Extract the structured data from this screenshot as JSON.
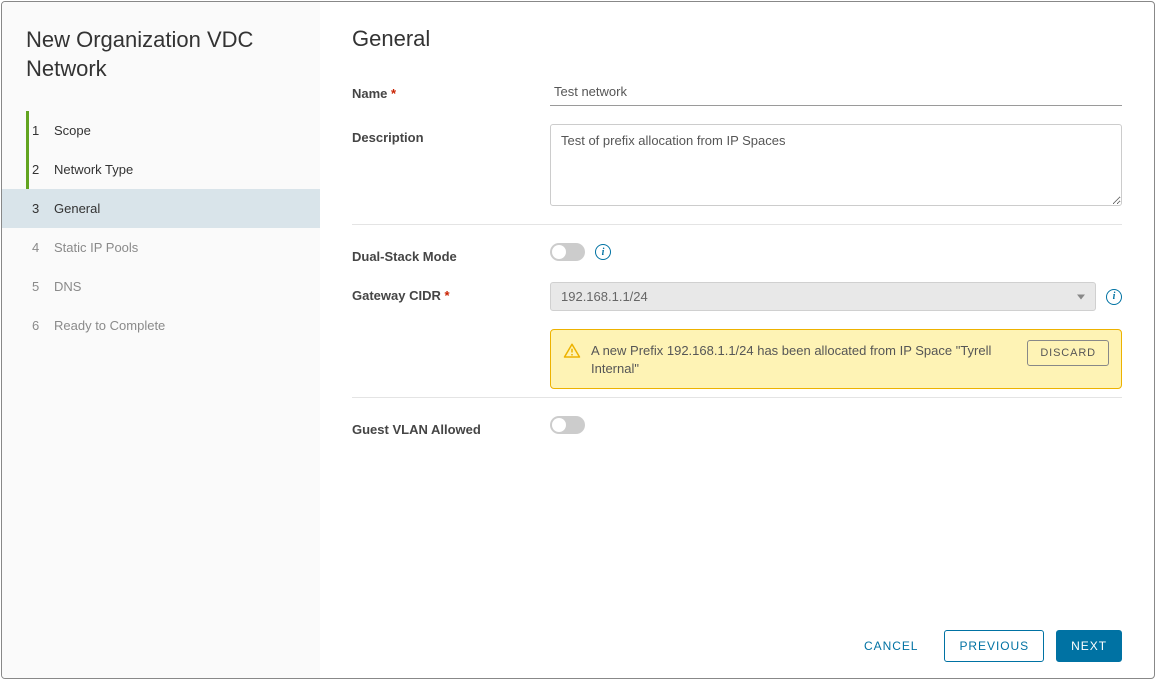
{
  "sidebar": {
    "title": "New Organization VDC Network",
    "steps": [
      {
        "num": "1",
        "label": "Scope",
        "state": "completed"
      },
      {
        "num": "2",
        "label": "Network Type",
        "state": "completed"
      },
      {
        "num": "3",
        "label": "General",
        "state": "active"
      },
      {
        "num": "4",
        "label": "Static IP Pools",
        "state": "pending"
      },
      {
        "num": "5",
        "label": "DNS",
        "state": "pending"
      },
      {
        "num": "6",
        "label": "Ready to Complete",
        "state": "pending"
      }
    ]
  },
  "page": {
    "title": "General",
    "name_label": "Name",
    "name_value": "Test network",
    "description_label": "Description",
    "description_value": "Test of prefix allocation from IP Spaces",
    "dual_stack_label": "Dual-Stack Mode",
    "gateway_cidr_label": "Gateway CIDR",
    "gateway_cidr_value": "192.168.1.1/24",
    "alert_text": "A new Prefix 192.168.1.1/24 has been allocated from IP Space \"Tyrell Internal\"",
    "discard_label": "DISCARD",
    "guest_vlan_label": "Guest VLAN Allowed"
  },
  "footer": {
    "cancel": "CANCEL",
    "previous": "PREVIOUS",
    "next": "NEXT"
  }
}
